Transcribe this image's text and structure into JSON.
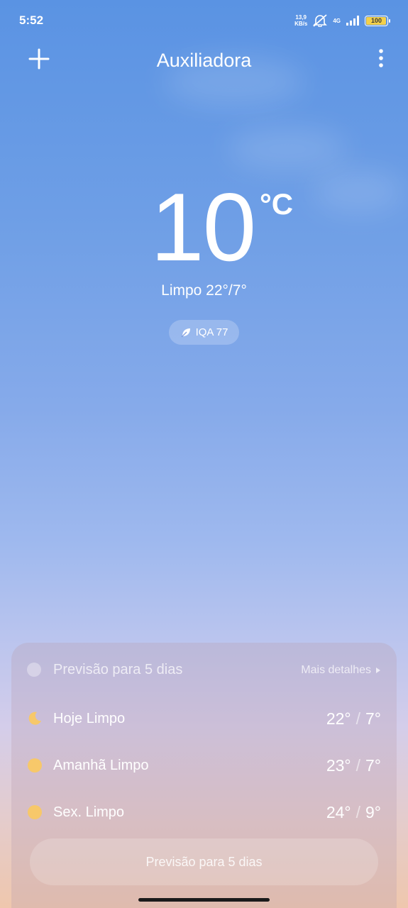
{
  "status": {
    "time": "5:52",
    "speed_value": "13,9",
    "speed_unit": "KB/s",
    "network": "4G",
    "battery": "100",
    "battery_color": "#f4d04a"
  },
  "header": {
    "city": "Auxiliadora"
  },
  "current": {
    "temperature": "10",
    "unit": "°C",
    "condition": "Limpo  22°/7°",
    "aqi": "IQA 77"
  },
  "forecast": {
    "title": "Previsão para 5 dias",
    "more": "Mais detalhes",
    "days": [
      {
        "label": "Hoje  Limpo",
        "high": "22°",
        "separator": "/",
        "low": "7°",
        "icon": "moon-icon"
      },
      {
        "label": "Amanhã  Limpo",
        "high": "23°",
        "separator": "/",
        "low": "7°",
        "icon": "sun-icon"
      },
      {
        "label": "Sex.  Limpo",
        "high": "24°",
        "separator": "/",
        "low": "9°",
        "icon": "sun-icon"
      }
    ],
    "button": "Previsão para 5 dias"
  }
}
